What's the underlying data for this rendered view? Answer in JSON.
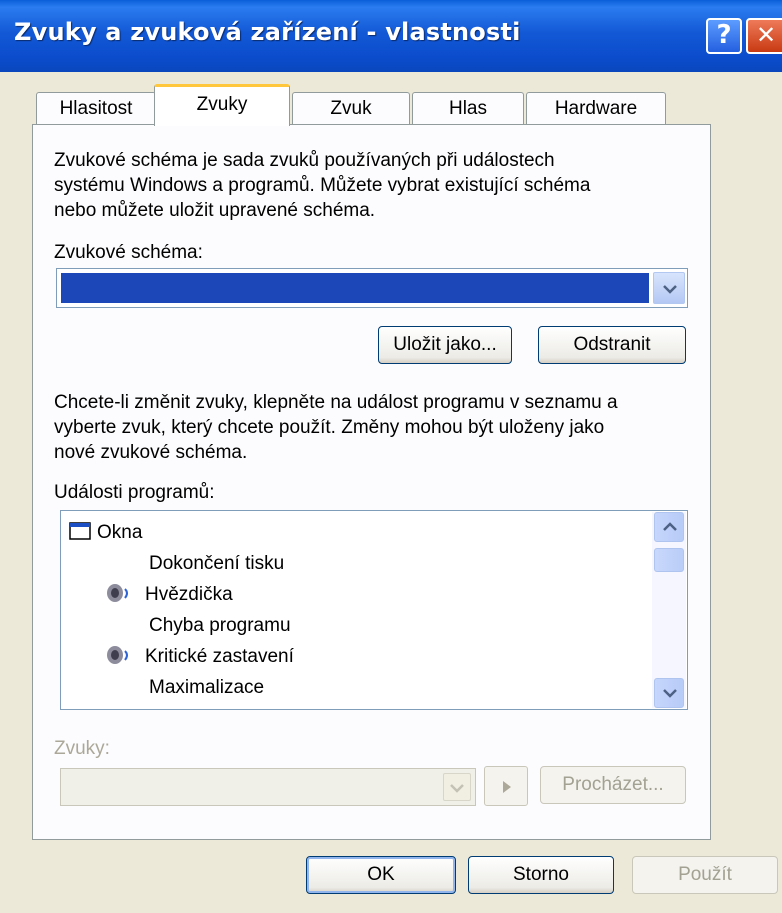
{
  "window": {
    "title": "Zvuky a zvuková zařízení - vlastnosti",
    "help_glyph": "?",
    "close_glyph": "✕"
  },
  "tabs": [
    {
      "label": "Hlasitost",
      "active": false
    },
    {
      "label": "Zvuky",
      "active": true
    },
    {
      "label": "Zvuk",
      "active": false
    },
    {
      "label": "Hlas",
      "active": false
    },
    {
      "label": "Hardware",
      "active": false
    }
  ],
  "scheme": {
    "description_lines": [
      "Zvukové schéma je sada zvuků používaných při událostech",
      "systému Windows a programů. Můžete vybrat existující schéma",
      "nebo můžete uložit upravené schéma."
    ],
    "label": "Zvukové schéma:",
    "selected_value": "",
    "save_as_label": "Uložit jako...",
    "delete_label": "Odstranit"
  },
  "events": {
    "description_lines": [
      "Chcete-li změnit zvuky, klepněte na událost programu v seznamu a",
      "vyberte zvuk, který chcete použít. Změny mohou být uloženy jako",
      "nové zvukové schéma."
    ],
    "label": "Události programů:",
    "items": [
      {
        "label": "Okna",
        "icon": "window-icon",
        "level": 0
      },
      {
        "label": "Dokončení tisku",
        "icon": "",
        "level": 1
      },
      {
        "label": "Hvězdička",
        "icon": "speaker-icon",
        "level": 1
      },
      {
        "label": "Chyba programu",
        "icon": "",
        "level": 1
      },
      {
        "label": "Kritické zastavení",
        "icon": "speaker-icon",
        "level": 1
      },
      {
        "label": "Maximalizace",
        "icon": "",
        "level": 1
      }
    ]
  },
  "sounds": {
    "label": "Zvuky:",
    "value": "",
    "browse_label": "Procházet..."
  },
  "footer": {
    "ok_label": "OK",
    "cancel_label": "Storno",
    "apply_label": "Použít"
  },
  "colors": {
    "titlebar": "#0b4ccc",
    "selection": "#1c47b8",
    "active_tab_accent": "#ffc83c"
  }
}
